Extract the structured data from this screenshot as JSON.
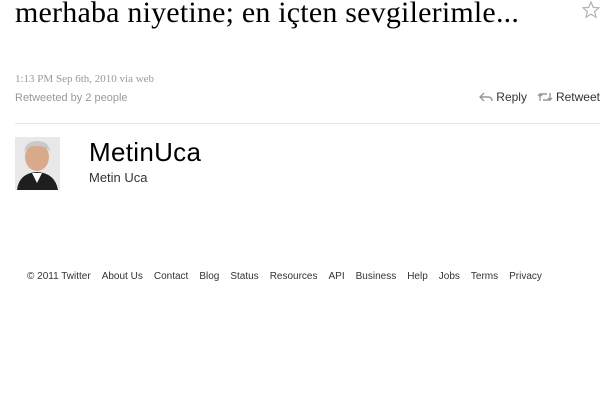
{
  "tweet": {
    "text": "merhaba niyetine; en içten sevgilerimle...",
    "timestamp": "1:13 PM Sep 6th, 2010",
    "via_label": "via web",
    "retweeted_by": "Retweeted by 2 people"
  },
  "actions": {
    "reply_label": "Reply",
    "retweet_label": "Retweet"
  },
  "user": {
    "screen_name": "MetinUca",
    "full_name": "Metin Uca"
  },
  "footer": {
    "copyright": "© 2011 Twitter",
    "links": [
      "About Us",
      "Contact",
      "Blog",
      "Status",
      "Resources",
      "API",
      "Business",
      "Help",
      "Jobs",
      "Terms",
      "Privacy"
    ]
  },
  "icons": {
    "favorite": "star-icon",
    "reply": "reply-arrow-icon",
    "retweet": "retweet-icon"
  }
}
